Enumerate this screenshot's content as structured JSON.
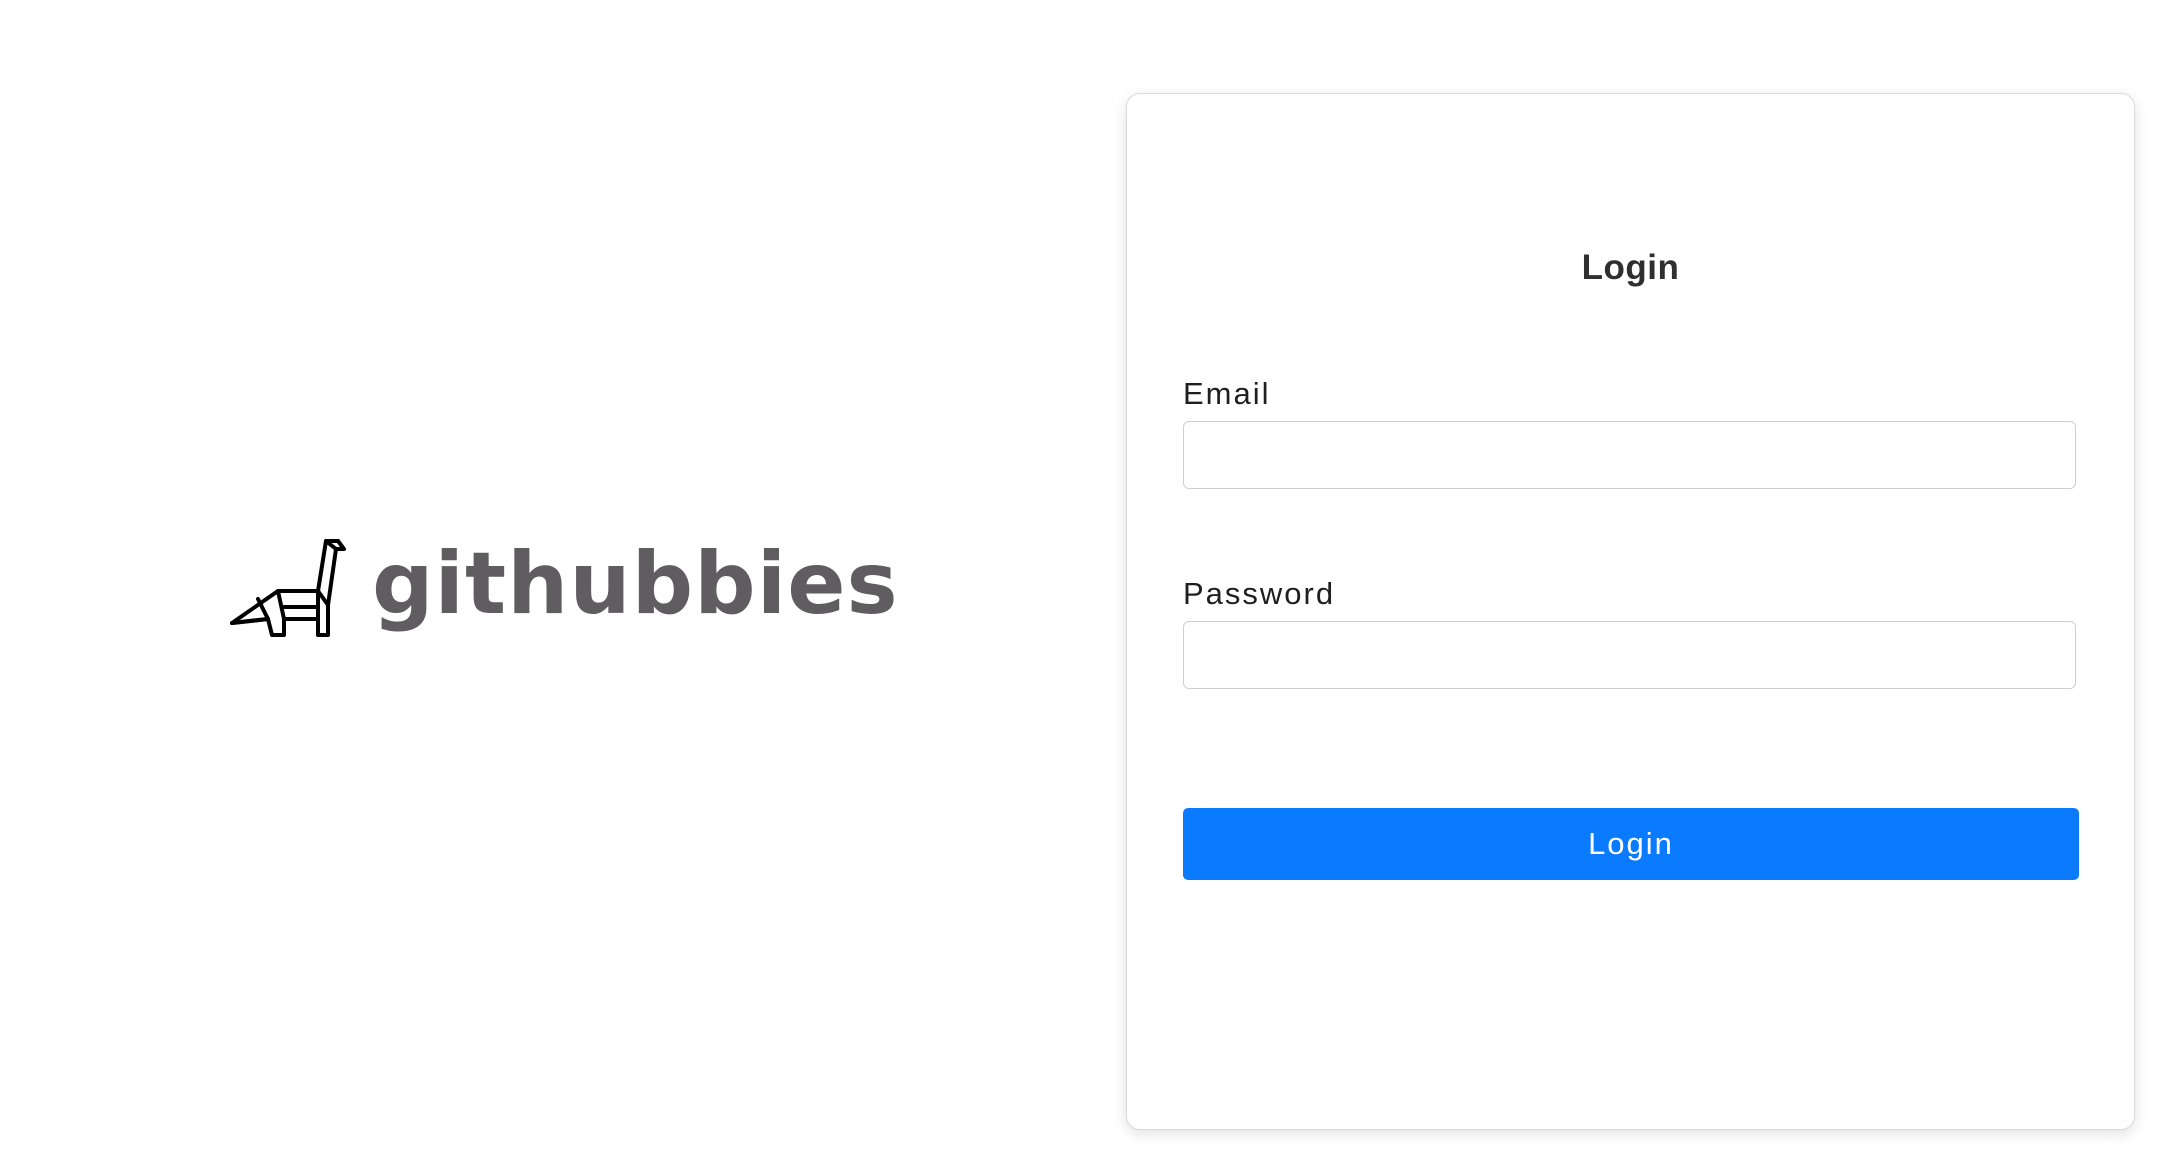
{
  "brand": {
    "name": "githubbies",
    "logo_icon": "origami-dinosaur-icon",
    "text_color": "#5f5d5f"
  },
  "login_form": {
    "title": "Login",
    "email": {
      "label": "Email",
      "value": "",
      "placeholder": ""
    },
    "password": {
      "label": "Password",
      "value": "",
      "placeholder": ""
    },
    "submit_label": "Login",
    "button_color": "#0a7bff"
  }
}
